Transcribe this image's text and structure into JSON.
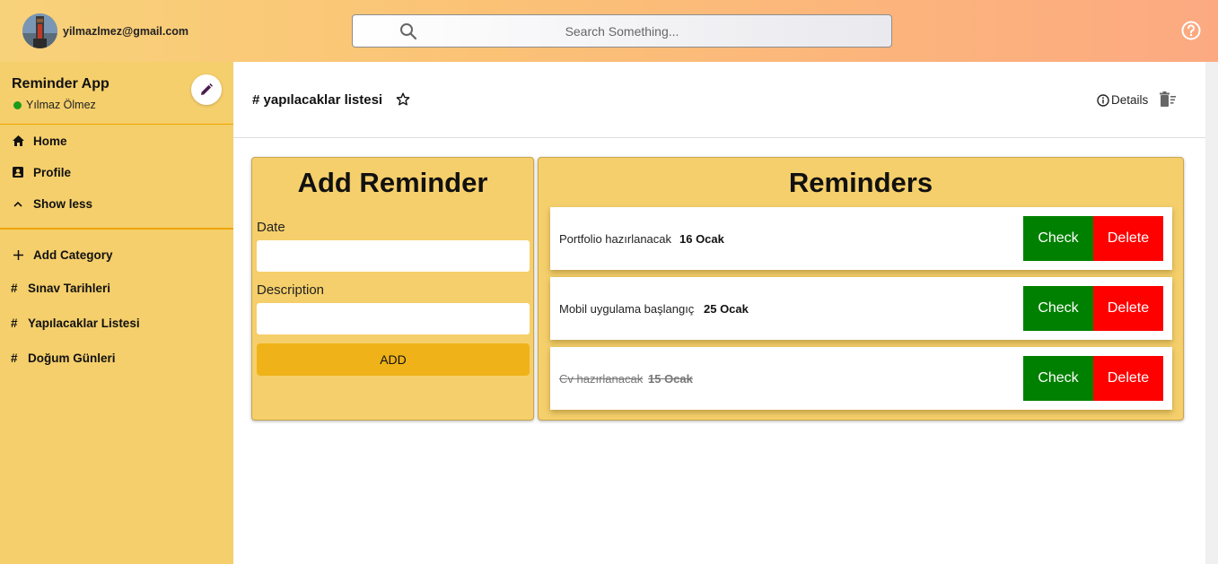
{
  "header": {
    "user_email": "yilmazlmez@gmail.com",
    "search_placeholder": "Search Something..."
  },
  "sidebar": {
    "app_title": "Reminder App",
    "user_name": "Yılmaz Ölmez",
    "status_color": "#1a9c1a",
    "nav": [
      {
        "label": "Home",
        "icon": "home-icon"
      },
      {
        "label": "Profile",
        "icon": "profile-icon"
      },
      {
        "label": "Show less",
        "icon": "chevron-up-icon"
      }
    ],
    "add_category_label": "Add Category",
    "categories": [
      {
        "label": "Sınav Tarihleri"
      },
      {
        "label": "Yapılacaklar Listesi"
      },
      {
        "label": "Doğum Günleri"
      }
    ]
  },
  "main": {
    "list_title": "# yapılacaklar listesi",
    "details_label": "Details",
    "add_card": {
      "title": "Add Reminder",
      "date_label": "Date",
      "date_value": "",
      "description_label": "Description",
      "description_value": "",
      "add_button": "ADD"
    },
    "reminders_card": {
      "title": "Reminders",
      "check_label": "Check",
      "delete_label": "Delete",
      "items": [
        {
          "text": "Portfolio hazırlanacak",
          "date": "16 Ocak",
          "done": false
        },
        {
          "text": "Mobil uygulama başlangıç",
          "date": "25 Ocak",
          "done": false
        },
        {
          "text": "Cv hazırlanacak",
          "date": "15 Ocak",
          "done": true
        }
      ]
    }
  },
  "colors": {
    "accent": "#f5cf6b",
    "check": "#008000",
    "delete": "#ff0000",
    "add_button": "#efb319"
  }
}
